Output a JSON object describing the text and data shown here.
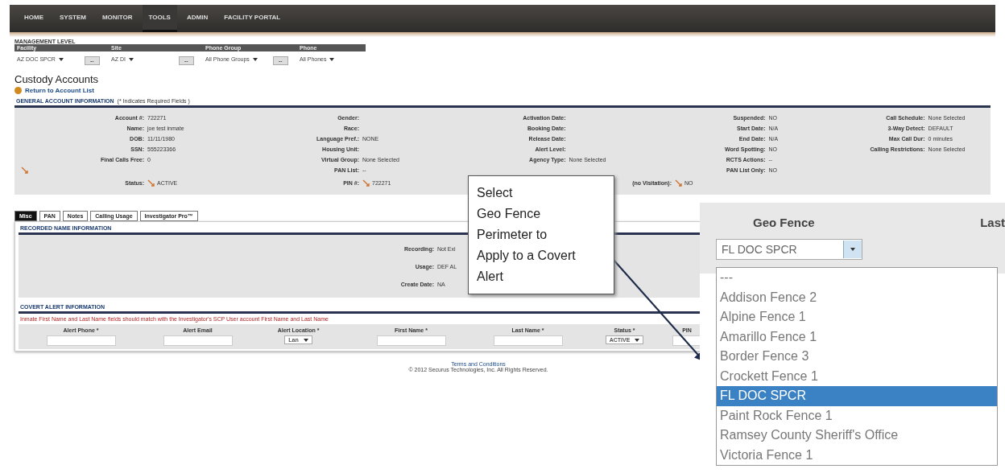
{
  "nav": [
    {
      "label": "HOME",
      "selected": false
    },
    {
      "label": "SYSTEM",
      "selected": false
    },
    {
      "label": "MONITOR",
      "selected": false
    },
    {
      "label": "TOOLS",
      "selected": true
    },
    {
      "label": "ADMIN",
      "selected": false
    },
    {
      "label": "FACILITY PORTAL",
      "selected": false
    }
  ],
  "management": {
    "title": "MANAGEMENT LEVEL",
    "columns": [
      {
        "label": "Facility",
        "value": "AZ DOC SPCR"
      },
      {
        "label": "Site",
        "value": "AZ DI"
      },
      {
        "label": "Phone Group",
        "value": "All Phone Groups"
      },
      {
        "label": "Phone",
        "value": "All Phones"
      }
    ],
    "button": "--"
  },
  "page_title": "Custody Accounts",
  "return_link": "Return to Account List",
  "general": {
    "title": "GENERAL ACCOUNT INFORMATION",
    "note": "(* Indicates Required Fields )",
    "columns": [
      [
        {
          "label": "Account #:",
          "value": "722271"
        },
        {
          "label": "Name:",
          "value": "joe test inmate"
        },
        {
          "label": "DOB:",
          "value": "11/11/1980"
        },
        {
          "label": "SSN:",
          "value": "555223366"
        },
        {
          "label": "Final Calls Free:",
          "value": "0"
        },
        {
          "kind": "icon"
        },
        {
          "label": "Status:",
          "value": "ACTIVE",
          "kind": "edit"
        }
      ],
      [
        {
          "label": "Gender:"
        },
        {
          "label": "Race:"
        },
        {
          "label": "Language Pref.:",
          "value": "NONE"
        },
        {
          "label": "Housing Unit:"
        },
        {
          "label": "Virtual Group:",
          "value": "None Selected"
        },
        {
          "label": "PAN List:",
          "value": "--"
        },
        {
          "label": "PIN #:",
          "value": "722271",
          "kind": "edit"
        }
      ],
      [
        {
          "label": "Activation Date:"
        },
        {
          "label": "Booking Date:"
        },
        {
          "label": "Release Date:"
        },
        {
          "label": "Alert Level:"
        },
        {
          "label": "Agency Type:",
          "value": "None Selected"
        },
        {
          "kind": "blank"
        },
        {
          "label": "(no Visitation):",
          "value": "NO",
          "kind": "wide"
        }
      ],
      [
        {
          "label": "Suspended:",
          "value": "NO"
        },
        {
          "label": "Start Date:",
          "value": "N/A"
        },
        {
          "label": "End Date:",
          "value": "N/A"
        },
        {
          "label": "Word Spotting:",
          "value": "NO"
        },
        {
          "label": "RCTS Actions:",
          "value": "--"
        },
        {
          "label": "PAN List Only:",
          "value": "NO"
        }
      ],
      [
        {
          "label": "Call Schedule:",
          "value": "None Selected"
        },
        {
          "label": "3-Way Detect:",
          "value": "DEFAULT"
        },
        {
          "label": "Max Call Dur:",
          "value": "0 minutes"
        },
        {
          "label": "Calling Restrictions:",
          "value": "None Selected"
        }
      ]
    ]
  },
  "tabs": [
    {
      "label": "Misc",
      "selected": true
    },
    {
      "label": "PAN",
      "selected": false
    },
    {
      "label": "Notes",
      "selected": false
    },
    {
      "label": "Calling Usage",
      "selected": false
    },
    {
      "label": "Investigator Pro™",
      "selected": false
    }
  ],
  "recorded": {
    "title": "RECORDED NAME INFORMATION",
    "rows": [
      {
        "label": "Recording:",
        "value": "Not Exi"
      },
      {
        "label": "Usage:",
        "value": "DEF AL"
      },
      {
        "label": "Create Date:",
        "value": "NA"
      }
    ]
  },
  "covert": {
    "title": "COVERT ALERT INFORMATION",
    "note": "Inmate First Name and Last Name fields should match with the Investigator's SCP User account First Name and Last Name",
    "columns": [
      {
        "label": "Alert Phone *",
        "kind": "input"
      },
      {
        "label": "Alert Email",
        "kind": "input"
      },
      {
        "label": "Alert Location *",
        "kind": "select",
        "value": "Lan"
      },
      {
        "label": "First Name *",
        "kind": "input"
      },
      {
        "label": "Last Name *",
        "kind": "input"
      },
      {
        "label": "Status *",
        "kind": "select",
        "value": "ACTIVE"
      },
      {
        "label": "PIN",
        "kind": "input"
      }
    ]
  },
  "footer": {
    "link": "Terms and Conditions",
    "copyright": "© 2012 Securus Technologies, Inc. All Rights Reserved."
  },
  "callout": {
    "lines": [
      "Select",
      "Geo Fence",
      "Perimeter to",
      "Apply to a Covert",
      "Alert"
    ]
  },
  "inset": {
    "headers": [
      "Geo Fence",
      "Last"
    ],
    "value": "FL DOC SPCR",
    "options": [
      {
        "label": "---",
        "selected": false
      },
      {
        "label": "Addison Fence 2",
        "selected": false
      },
      {
        "label": "Alpine Fence 1",
        "selected": false
      },
      {
        "label": "Amarillo Fence 1",
        "selected": false
      },
      {
        "label": "Border Fence 3",
        "selected": false
      },
      {
        "label": "Crockett Fence 1",
        "selected": false
      },
      {
        "label": "FL DOC SPCR",
        "selected": true
      },
      {
        "label": "Paint Rock Fence 1",
        "selected": false
      },
      {
        "label": "Ramsey County Sheriff's Office",
        "selected": false
      },
      {
        "label": "Victoria Fence 1",
        "selected": false
      }
    ]
  }
}
